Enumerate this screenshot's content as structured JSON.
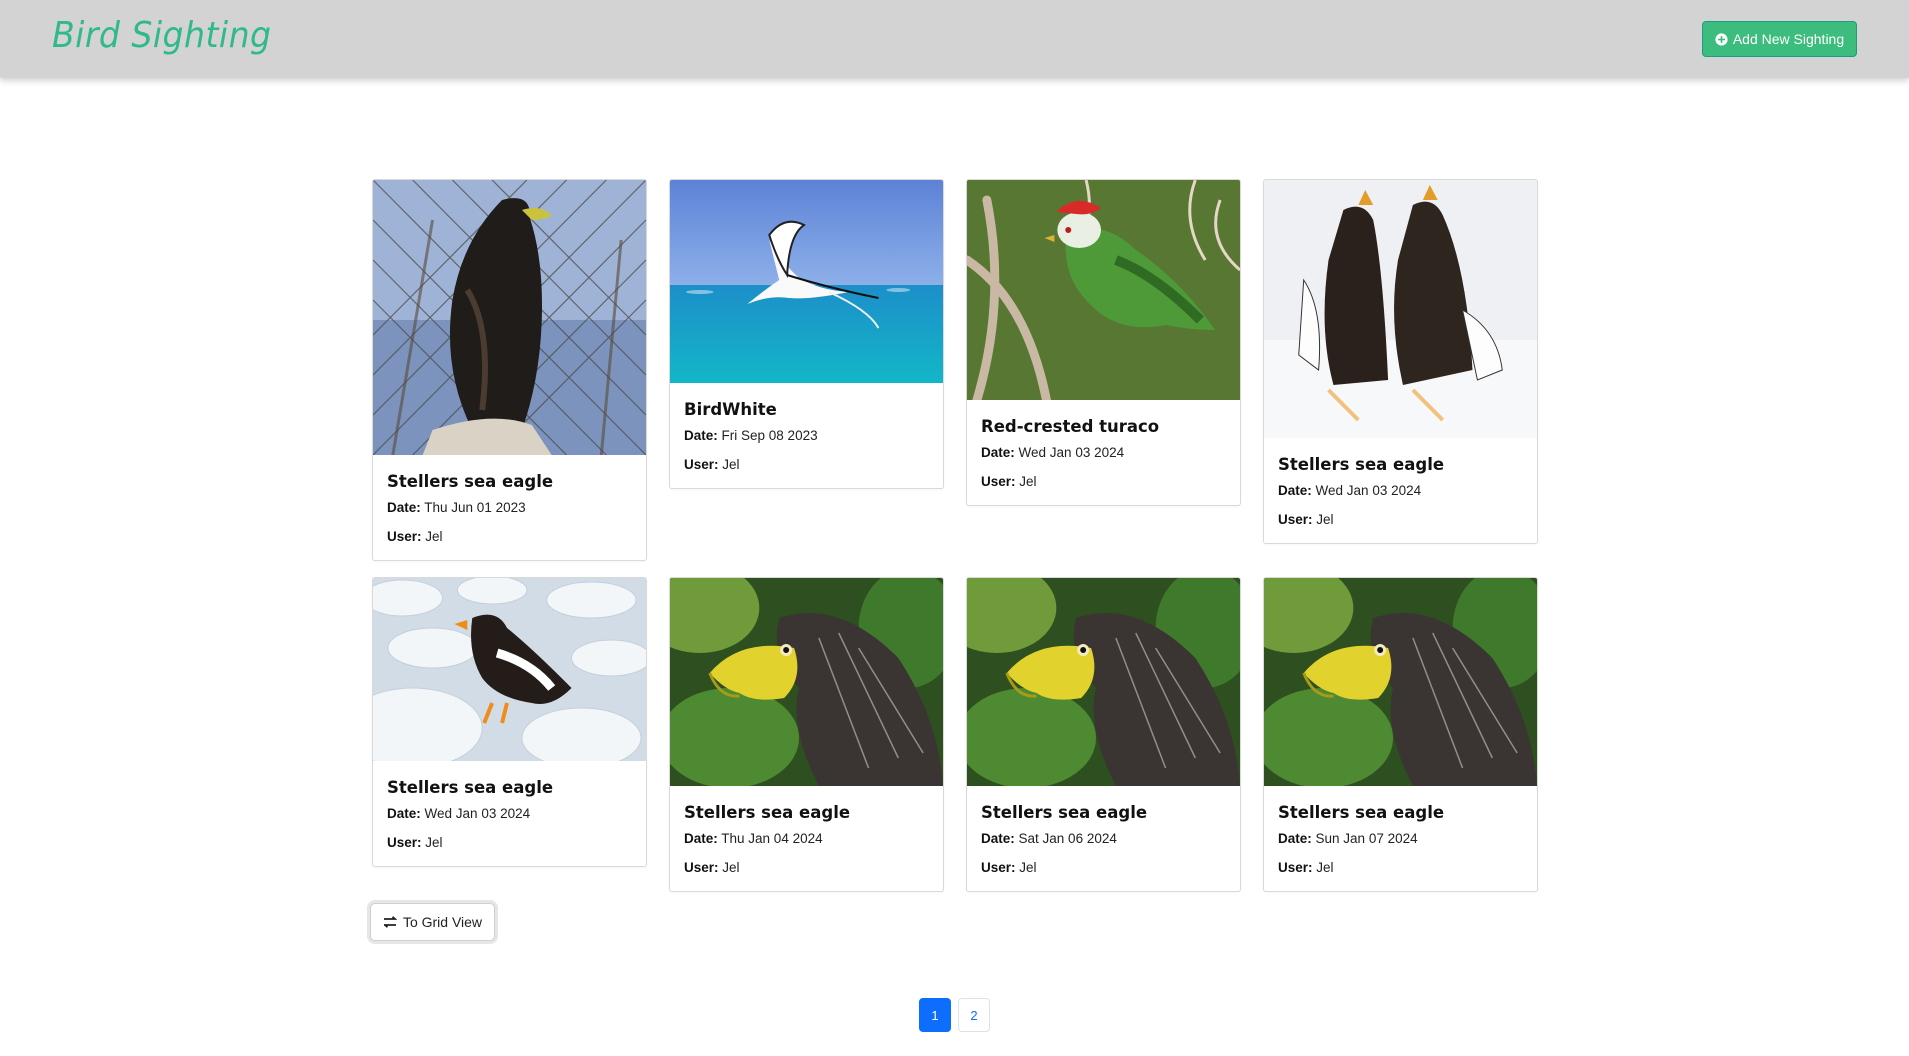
{
  "header": {
    "brand": "Bird Sighting",
    "add_button_label": "Add New Sighting",
    "brand_color": "#2fb98c",
    "accent_color": "#3cbc7d"
  },
  "cards": [
    {
      "title": "Stellers sea eagle",
      "date_label": "Date:",
      "date": "Thu Jun 01 2023",
      "user_label": "User:",
      "user": "Jel",
      "image": "eagle-perched-fence"
    },
    {
      "title": "BirdWhite",
      "date_label": "Date:",
      "date": "Fri Sep 08 2023",
      "user_label": "User:",
      "user": "Jel",
      "image": "white-tropicbird-over-sea"
    },
    {
      "title": "Red-crested turaco",
      "date_label": "Date:",
      "date": "Wed Jan 03 2024",
      "user_label": "User:",
      "user": "Jel",
      "image": "turaco-on-branch"
    },
    {
      "title": "Stellers sea eagle",
      "date_label": "Date:",
      "date": "Wed Jan 03 2024",
      "user_label": "User:",
      "user": "Jel",
      "image": "two-eagles-in-snow"
    },
    {
      "title": "Stellers sea eagle",
      "date_label": "Date:",
      "date": "Wed Jan 03 2024",
      "user_label": "User:",
      "user": "Jel",
      "image": "eagle-on-ice"
    },
    {
      "title": "Stellers sea eagle",
      "date_label": "Date:",
      "date": "Thu Jan 04 2024",
      "user_label": "User:",
      "user": "Jel",
      "image": "eagle-head-closeup"
    },
    {
      "title": "Stellers sea eagle",
      "date_label": "Date:",
      "date": "Sat Jan 06 2024",
      "user_label": "User:",
      "user": "Jel",
      "image": "eagle-head-closeup"
    },
    {
      "title": "Stellers sea eagle",
      "date_label": "Date:",
      "date": "Sun Jan 07 2024",
      "user_label": "User:",
      "user": "Jel",
      "image": "eagle-head-closeup"
    }
  ],
  "view_toggle_label": "To Grid View",
  "pagination": {
    "pages": [
      "1",
      "2"
    ],
    "current": "1"
  }
}
